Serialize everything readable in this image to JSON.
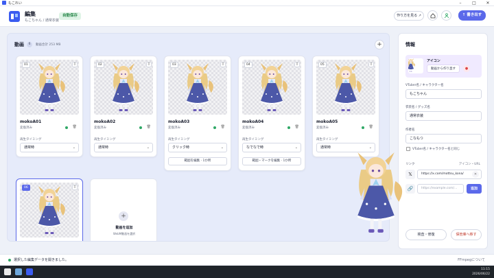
{
  "window": {
    "title": "もこれい"
  },
  "header": {
    "title": "編集",
    "breadcrumb": "もこちゃん / 通常衣装",
    "autosave": "自動保存",
    "howto": "作り方を見る ↗",
    "export": "↑ 書き出す"
  },
  "videos": {
    "title": "動画",
    "count": "6",
    "size_total": "動画合計 253 MB",
    "items": [
      {
        "index": "01",
        "name": "mokoA01",
        "status": "変換済み",
        "timing_label": "再生タイミング",
        "timing": "通常時"
      },
      {
        "index": "02",
        "name": "mokoA02",
        "status": "変換済み",
        "timing_label": "再生タイミング",
        "timing": "通常時"
      },
      {
        "index": "03",
        "name": "mokoA03",
        "status": "変換済み",
        "timing_label": "再生タイミング",
        "timing": "クリック時",
        "range": "範囲を編集 · 1か所"
      },
      {
        "index": "04",
        "name": "mokoA04",
        "status": "変換済み",
        "timing_label": "再生タイミング",
        "timing": "なでなで時",
        "range": "範囲・マークを編集 · 1か所"
      },
      {
        "index": "05",
        "name": "mokoA05",
        "status": "変換済み",
        "timing_label": "再生タイミング",
        "timing": "通常時"
      },
      {
        "index": "06"
      }
    ],
    "add_card": {
      "title": "動画を追加",
      "subtitle": "WebM動画を選択"
    }
  },
  "info": {
    "title": "情報",
    "icon_label": "アイコン",
    "icon_make": "動画から作り直す",
    "vtuber_label": "VTuber名 / キャラクター名",
    "vtuber_value": "もこちゃん",
    "costume_label": "衣装名 / グッズ名",
    "costume_value": "通常衣装",
    "author_label": "作者名",
    "author_value": "こなもつ",
    "same_as_vtuber": "VTuber名 / キャラクター名と同じ",
    "links_label": "リンク",
    "links_right": "アイコン・URL",
    "link1_value": "https://x.com/mottsu_kona/",
    "link2_placeholder": "https://example.com/...",
    "add_button": "追加",
    "check_button": "検査・修復",
    "save_button": "保管庫へ移す"
  },
  "status": {
    "message": "選択した編集データを開きました。",
    "ffmpeg": "FFmpegについて"
  },
  "taskbar": {
    "time": "11:15",
    "date": "2026/06/22"
  },
  "colors": {
    "accent": "#5b69ea",
    "success": "#2fa866",
    "danger": "#c0392b"
  }
}
